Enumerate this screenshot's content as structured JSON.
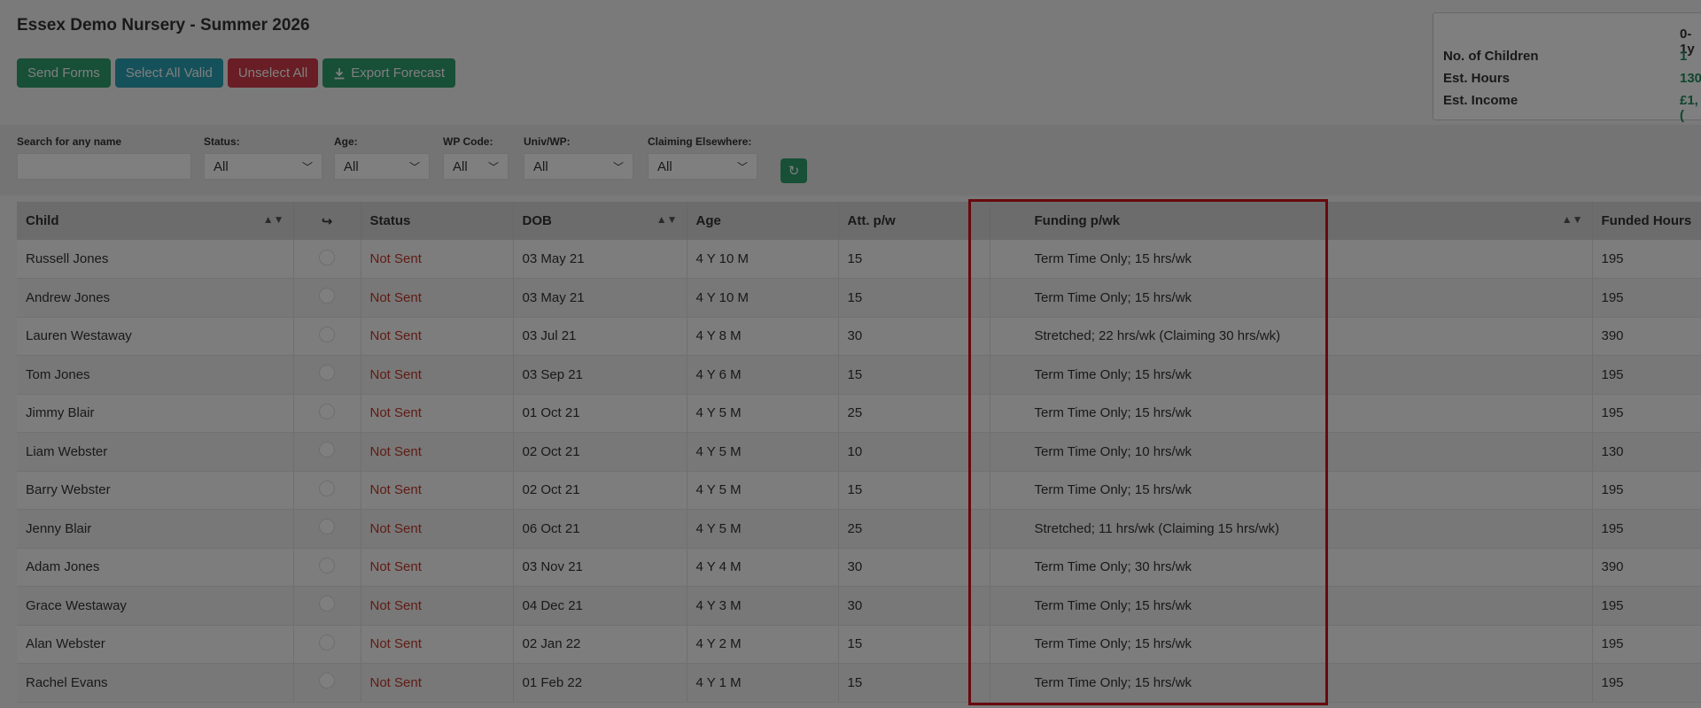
{
  "page_title": "Essex Demo Nursery - Summer 2026",
  "buttons": {
    "send_forms": "Send Forms",
    "select_all_valid": "Select All Valid",
    "unselect_all": "Unselect All",
    "export_forecast": "Export Forecast"
  },
  "summary": {
    "column_header": "0-1y",
    "rows": [
      {
        "label": "No. of Children",
        "value": "1"
      },
      {
        "label": "Est. Hours",
        "value": "130"
      },
      {
        "label": "Est. Income",
        "value": "£1,("
      }
    ]
  },
  "filters": {
    "search_label": "Search for any name",
    "search_value": "",
    "status_label": "Status:",
    "status_value": "All",
    "age_label": "Age:",
    "age_value": "All",
    "wp_code_label": "WP Code:",
    "wp_code_value": "All",
    "univ_wp_label": "Univ/WP:",
    "univ_wp_value": "All",
    "claiming_label": "Claiming Elsewhere:",
    "claiming_value": "All"
  },
  "table": {
    "headers": {
      "child": "Child",
      "status": "Status",
      "dob": "DOB",
      "age": "Age",
      "att": "Att. p/w",
      "funding": "Funding p/wk",
      "funded_hours": "Funded Hours"
    },
    "rows": [
      {
        "child": "Russell Jones",
        "status": "Not Sent",
        "dob": "03 May 21",
        "age": "4 Y 10 M",
        "att": "15",
        "funding": "Term Time Only; 15 hrs/wk",
        "funded": "195"
      },
      {
        "child": "Andrew Jones",
        "status": "Not Sent",
        "dob": "03 May 21",
        "age": "4 Y 10 M",
        "att": "15",
        "funding": "Term Time Only; 15 hrs/wk",
        "funded": "195"
      },
      {
        "child": "Lauren Westaway",
        "status": "Not Sent",
        "dob": "03 Jul 21",
        "age": "4 Y 8 M",
        "att": "30",
        "funding": "Stretched; 22 hrs/wk (Claiming 30 hrs/wk)",
        "funded": "390"
      },
      {
        "child": "Tom Jones",
        "status": "Not Sent",
        "dob": "03 Sep 21",
        "age": "4 Y 6 M",
        "att": "15",
        "funding": "Term Time Only; 15 hrs/wk",
        "funded": "195"
      },
      {
        "child": "Jimmy Blair",
        "status": "Not Sent",
        "dob": "01 Oct 21",
        "age": "4 Y 5 M",
        "att": "25",
        "funding": "Term Time Only; 15 hrs/wk",
        "funded": "195"
      },
      {
        "child": "Liam Webster",
        "status": "Not Sent",
        "dob": "02 Oct 21",
        "age": "4 Y 5 M",
        "att": "10",
        "funding": "Term Time Only; 10 hrs/wk",
        "funded": "130"
      },
      {
        "child": "Barry Webster",
        "status": "Not Sent",
        "dob": "02 Oct 21",
        "age": "4 Y 5 M",
        "att": "15",
        "funding": "Term Time Only; 15 hrs/wk",
        "funded": "195"
      },
      {
        "child": "Jenny Blair",
        "status": "Not Sent",
        "dob": "06 Oct 21",
        "age": "4 Y 5 M",
        "att": "25",
        "funding": "Stretched; 11 hrs/wk (Claiming 15 hrs/wk)",
        "funded": "195"
      },
      {
        "child": "Adam Jones",
        "status": "Not Sent",
        "dob": "03 Nov 21",
        "age": "4 Y 4 M",
        "att": "30",
        "funding": "Term Time Only; 30 hrs/wk",
        "funded": "390"
      },
      {
        "child": "Grace Westaway",
        "status": "Not Sent",
        "dob": "04 Dec 21",
        "age": "4 Y 3 M",
        "att": "30",
        "funding": "Term Time Only; 15 hrs/wk",
        "funded": "195"
      },
      {
        "child": "Alan Webster",
        "status": "Not Sent",
        "dob": "02 Jan 22",
        "age": "4 Y 2 M",
        "att": "15",
        "funding": "Term Time Only; 15 hrs/wk",
        "funded": "195"
      },
      {
        "child": "Rachel Evans",
        "status": "Not Sent",
        "dob": "01 Feb 22",
        "age": "4 Y 1 M",
        "att": "15",
        "funding": "Term Time Only; 15 hrs/wk",
        "funded": "195"
      }
    ]
  },
  "colors": {
    "highlight": "#d0121b",
    "status_not_sent": "#c0392b",
    "accent_green": "#2e9e6f"
  }
}
